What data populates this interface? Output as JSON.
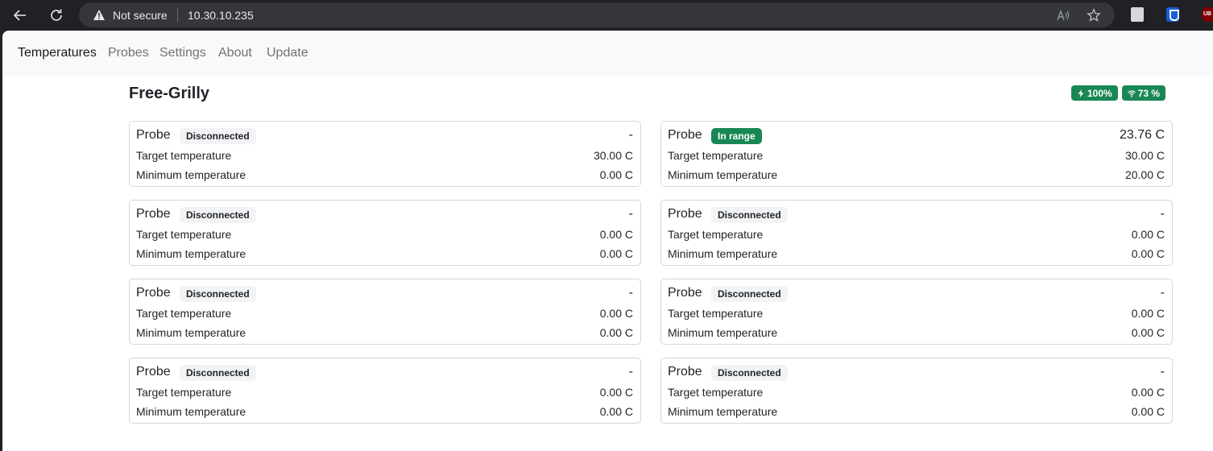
{
  "browser": {
    "security_label": "Not secure",
    "url": "10.30.10.235",
    "extension_ub_label": "UB"
  },
  "navbar": {
    "links": [
      {
        "label": "Temperatures",
        "active": true
      },
      {
        "label": "Probes"
      },
      {
        "label": "Settings"
      },
      {
        "label": "About"
      },
      {
        "label": "Update"
      }
    ]
  },
  "device": {
    "name": "Free-Grilly",
    "battery": "100%",
    "wifi": "73 %"
  },
  "probe_row_labels": {
    "probe": "Probe",
    "target": "Target temperature",
    "minimum": "Minimum temperature"
  },
  "probes": [
    {
      "status": "Disconnected",
      "value": "-",
      "target": "30.00 C",
      "minimum": "0.00 C"
    },
    {
      "status": "In range",
      "value": "23.76 C",
      "target": "30.00 C",
      "minimum": "20.00 C"
    },
    {
      "status": "Disconnected",
      "value": "-",
      "target": "0.00 C",
      "minimum": "0.00 C"
    },
    {
      "status": "Disconnected",
      "value": "-",
      "target": "0.00 C",
      "minimum": "0.00 C"
    },
    {
      "status": "Disconnected",
      "value": "-",
      "target": "0.00 C",
      "minimum": "0.00 C"
    },
    {
      "status": "Disconnected",
      "value": "-",
      "target": "0.00 C",
      "minimum": "0.00 C"
    },
    {
      "status": "Disconnected",
      "value": "-",
      "target": "0.00 C",
      "minimum": "0.00 C"
    },
    {
      "status": "Disconnected",
      "value": "-",
      "target": "0.00 C",
      "minimum": "0.00 C"
    }
  ],
  "colors": {
    "success": "#198754",
    "neutral_badge": "#f2f3f5",
    "navbar_bg": "#f8f9fa"
  }
}
